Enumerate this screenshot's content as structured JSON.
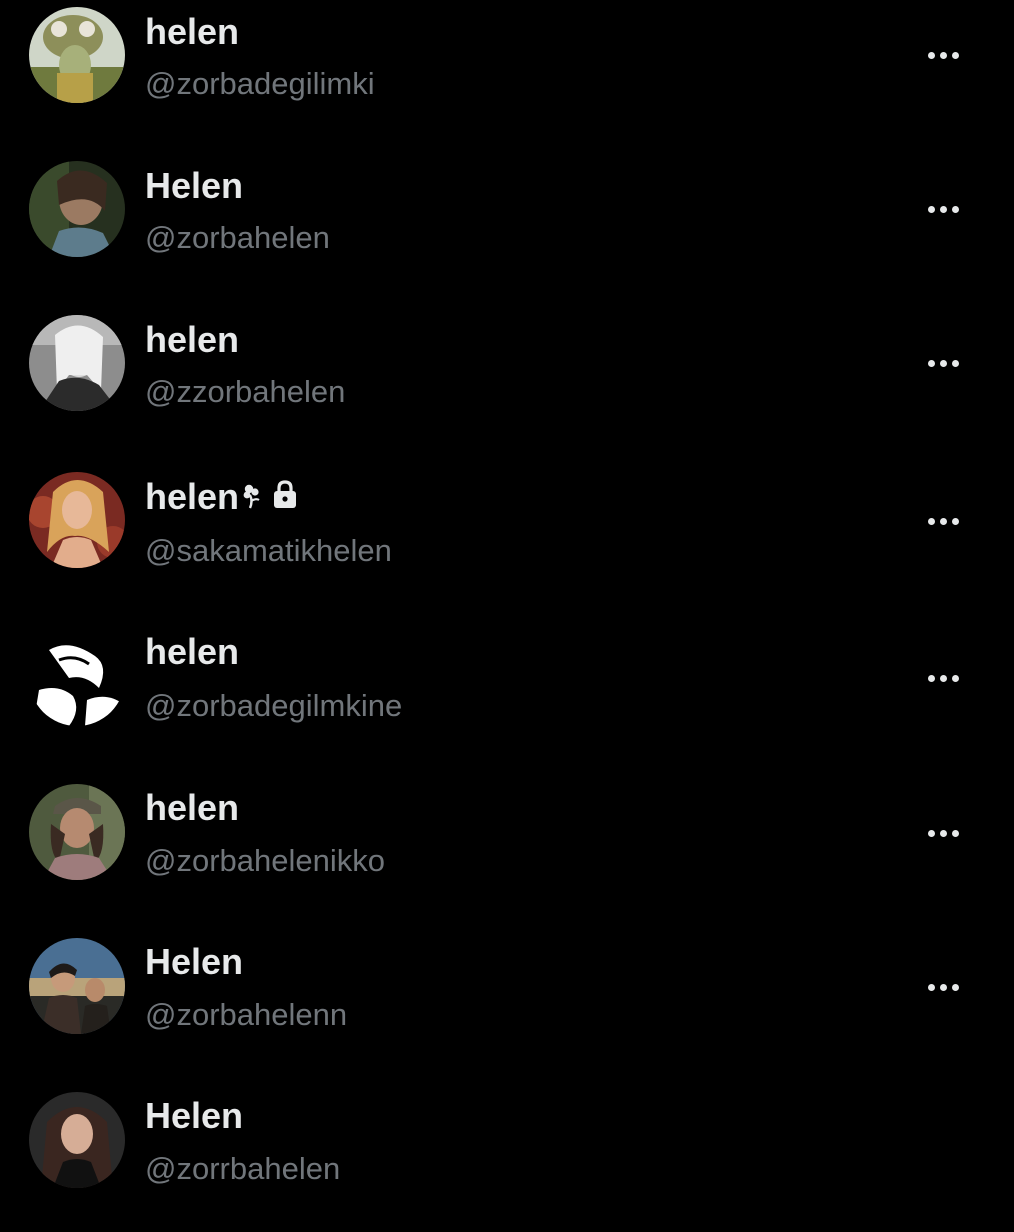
{
  "theme": {
    "background": "#000000",
    "name_color": "#e7e9ea",
    "handle_color": "#71767b"
  },
  "accounts": [
    {
      "display_name": "helen",
      "handle": "@zorbadegilimki",
      "avatar": "avatar-icon",
      "has_menu": true
    },
    {
      "display_name": "Helen",
      "handle": "@zorbahelen",
      "avatar": "avatar-icon",
      "has_menu": true
    },
    {
      "display_name": "helen",
      "handle": "@zzorbahelen",
      "avatar": "avatar-icon",
      "has_menu": true
    },
    {
      "display_name": "helen",
      "handle": "@sakamatikhelen",
      "avatar": "avatar-icon",
      "has_menu": true,
      "name_icons": [
        "flower-icon",
        "lock-icon"
      ]
    },
    {
      "display_name": "helen",
      "handle": "@zorbadegilmkine",
      "avatar": "avatar-icon",
      "has_menu": true
    },
    {
      "display_name": "helen",
      "handle": "@zorbahelenikko",
      "avatar": "avatar-icon",
      "has_menu": true
    },
    {
      "display_name": "Helen",
      "handle": "@zorbahelenn",
      "avatar": "avatar-icon",
      "has_menu": true
    },
    {
      "display_name": "Helen",
      "handle": "@zorrbahelen",
      "avatar": "avatar-icon",
      "has_menu": false
    }
  ]
}
